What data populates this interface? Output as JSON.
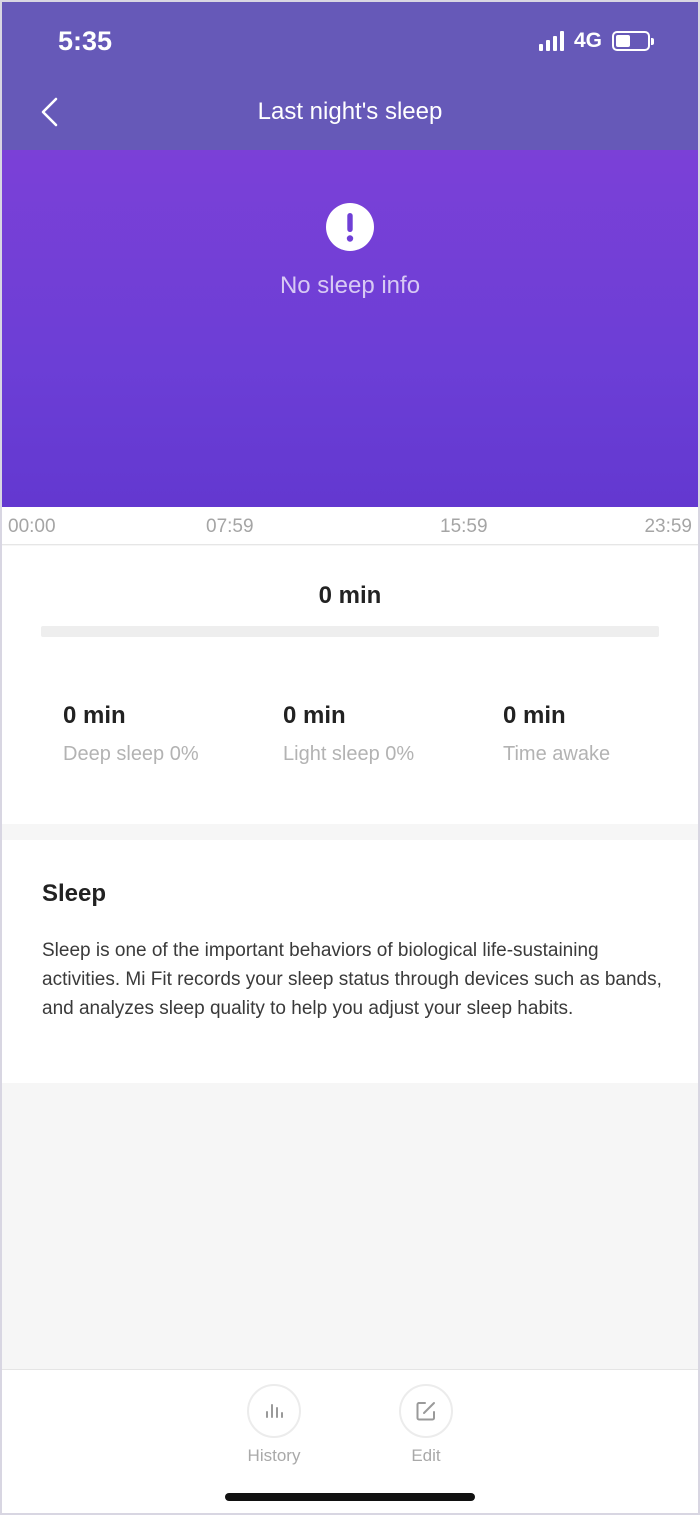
{
  "status_bar": {
    "time": "5:35",
    "network": "4G",
    "battery_level": 0.45
  },
  "header": {
    "title": "Last night's sleep"
  },
  "hero": {
    "message": "No sleep info",
    "icon": "alert-circle-icon"
  },
  "timeline": {
    "ticks": [
      "00:00",
      "07:59",
      "15:59",
      "23:59"
    ]
  },
  "summary": {
    "total": "0 min",
    "stats": [
      {
        "value": "0 min",
        "label": "Deep sleep 0%"
      },
      {
        "value": "0 min",
        "label": "Light sleep 0%"
      },
      {
        "value": "0 min",
        "label": "Time awake"
      }
    ]
  },
  "info": {
    "title": "Sleep",
    "body": "Sleep is one of the important behaviors of biological life-sustaining activities. Mi Fit records your sleep status through devices such as bands, and analyzes sleep quality to help you adjust your sleep habits."
  },
  "bottom_nav": {
    "history_label": "History",
    "edit_label": "Edit"
  },
  "colors": {
    "header": "#6659b8",
    "hero_top": "#7b40d7",
    "hero_bottom": "#6338d0"
  }
}
